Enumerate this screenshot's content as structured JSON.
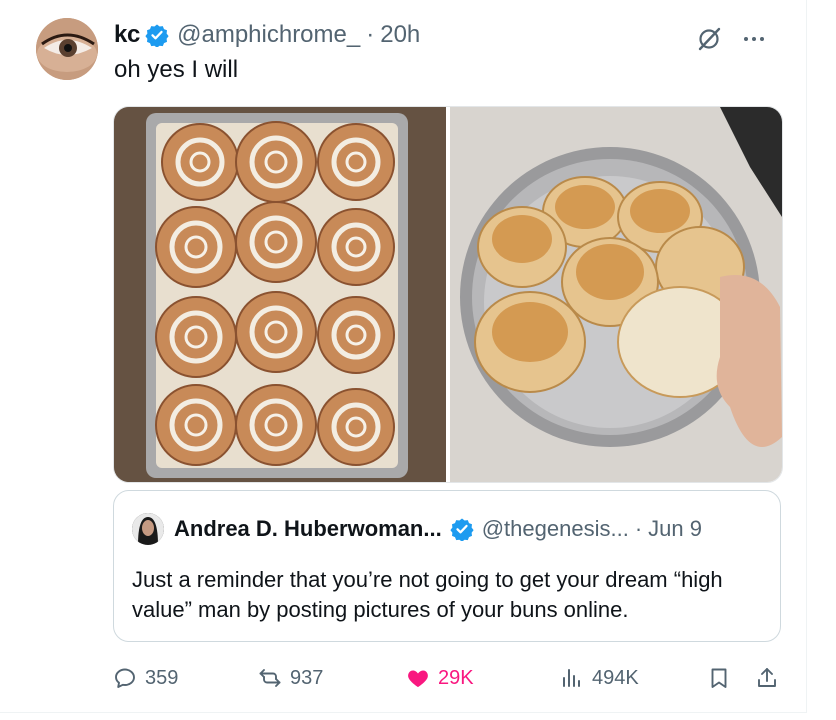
{
  "tweet": {
    "display_name": "kc",
    "handle": "@amphichrome_",
    "separator": "·",
    "time": "20h",
    "text": "oh yes I will",
    "verified": true,
    "more_icon": "more-dots-icon",
    "grok_icon": "slash-circle-icon"
  },
  "media": [
    {
      "alt_icon": "cinnamon-rolls-photo"
    },
    {
      "alt_icon": "dinner-rolls-photo"
    }
  ],
  "quote": {
    "display_name": "Andrea D. Huberwoman...",
    "handle": "@thegenesis...",
    "separator": "·",
    "time": "Jun 9",
    "text": "Just a reminder that you’re not going to get your dream “high value” man by posting pictures of your buns online."
  },
  "actions": {
    "replies": "359",
    "reposts": "937",
    "likes": "29K",
    "views": "494K"
  },
  "colors": {
    "verified": "#1d9bf0",
    "like": "#f91880",
    "secondary_text": "#536471"
  }
}
